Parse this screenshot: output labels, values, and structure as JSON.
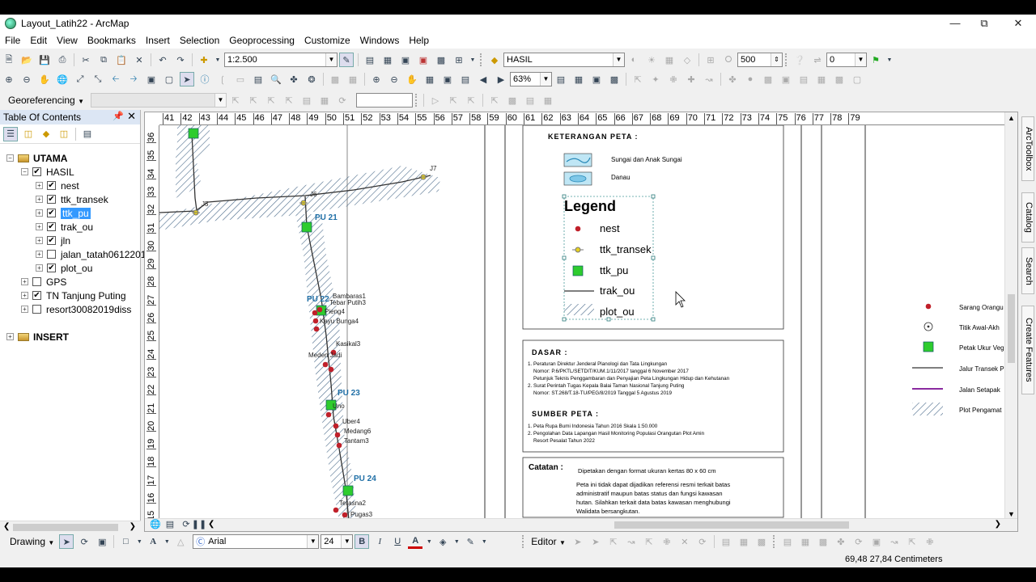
{
  "window": {
    "title": "Layout_Latih22 - ArcMap"
  },
  "menu": [
    "File",
    "Edit",
    "View",
    "Bookmarks",
    "Insert",
    "Selection",
    "Geoprocessing",
    "Customize",
    "Windows",
    "Help"
  ],
  "toolbar": {
    "scale": "1:2.500",
    "layer": "HASIL",
    "size_value": "500",
    "angle_value": "0",
    "zoom_percent": "63%"
  },
  "georef": {
    "label": "Georeferencing"
  },
  "toc": {
    "title": "Table Of Contents",
    "items": [
      {
        "label": "UTAMA",
        "level": 0,
        "checked": null,
        "expanded": true,
        "frame": true
      },
      {
        "label": "HASIL",
        "level": 1,
        "checked": true,
        "expanded": true
      },
      {
        "label": "nest",
        "level": 2,
        "checked": true
      },
      {
        "label": "ttk_transek",
        "level": 2,
        "checked": true
      },
      {
        "label": "ttk_pu",
        "level": 2,
        "checked": true,
        "selected": true
      },
      {
        "label": "trak_ou",
        "level": 2,
        "checked": true
      },
      {
        "label": "jln",
        "level": 2,
        "checked": true
      },
      {
        "label": "jalan_tatah0612201",
        "level": 2,
        "checked": false
      },
      {
        "label": "plot_ou",
        "level": 2,
        "checked": true
      },
      {
        "label": "GPS",
        "level": 1,
        "checked": false
      },
      {
        "label": "TN Tanjung Puting",
        "level": 1,
        "checked": true
      },
      {
        "label": "resort30082019diss",
        "level": 1,
        "checked": false
      },
      {
        "label": "INSERT",
        "level": 0,
        "checked": null,
        "frame": true
      }
    ]
  },
  "ruler_top": [
    "41",
    "42",
    "43",
    "44",
    "45",
    "46",
    "47",
    "48",
    "49",
    "50",
    "51",
    "52",
    "53",
    "54",
    "55",
    "56",
    "57",
    "58",
    "59",
    "60",
    "61",
    "62",
    "63",
    "64",
    "65",
    "66",
    "67",
    "68",
    "69",
    "70",
    "71",
    "72",
    "73",
    "74",
    "75",
    "76",
    "77",
    "78",
    "79"
  ],
  "ruler_left": [
    "36",
    "35",
    "34",
    "33",
    "32",
    "31",
    "30",
    "29",
    "28",
    "27",
    "26",
    "25",
    "24",
    "23",
    "22",
    "21",
    "20",
    "19",
    "18",
    "17",
    "16",
    "15"
  ],
  "map": {
    "plots": [
      "PU 21",
      "PU 22",
      "PU 23",
      "PU 24"
    ],
    "transect_points": [
      "J5",
      "J6",
      "J7"
    ],
    "nest_labels": [
      "Bambaras1",
      "Tebar Putih3",
      "Pieng4",
      "Kayu Bunga4",
      "Kasikal3",
      "Meden Jadi",
      "Uno",
      "Uber4",
      "Medang6",
      "Tantam3",
      "Terasna2",
      "Pugas3"
    ]
  },
  "keterangan": {
    "title": "KETERANGAN PETA :",
    "sungai": "Sungai dan Anak Sungai",
    "danau": "Danau",
    "legend_title": "Legend",
    "legend_items": [
      "nest",
      "ttk_transek",
      "ttk_pu",
      "trak_ou",
      "plot_ou"
    ]
  },
  "dasar": {
    "title": "DASAR :",
    "lines": [
      "1. Peraturan Direktur Jenderal Planologi dan Tata Lingkungan",
      "Nomor: P.6/PKTL/SETDIT/KUM.1/11/2017 tanggal 6 November 2017",
      "Petunjuk Teknis Penggambaran dan Penyajian Peta Lingkungan Hidup dan Kehutanan",
      "2. Surat Perintah Tugas Kepala Balai Taman Nasional Tanjung Puting",
      "Nomor: ST.268/T.18-TU/PEG/8/2019 Tanggal 5 Agustus 2019"
    ],
    "sumber_title": "SUMBER PETA :",
    "sumber_lines": [
      "1. Peta Rupa Bumi Indonesia Tahun 2016 Skala 1:50.000",
      "2. Pengolahan Data Lapangan Hasil Monitoring Populasi Orangutan Plot Amin",
      "Resort Pesalat Tahun 2022"
    ]
  },
  "catatan": {
    "title": "Catatan :",
    "line1": "Dipetakan dengan format ukuran kertas 80 x 60 cm",
    "para": [
      "Peta ini tidak dapat dijadikan referensi resmi terkait batas",
      "administratif maupun batas status dan fungsi kawasan",
      "hutan. Silahkan terkait data batas kawasan menghubungi",
      "Walidata bersangkutan."
    ]
  },
  "right_legend": [
    "Sarang Orangu",
    "Titik Awal-Akh",
    "Petak Ukur Veg",
    "Jalur Transek P",
    "Jalan Setapak",
    "Plot Pengamat"
  ],
  "sidetabs": [
    "ArcToolbox",
    "Catalog",
    "Search",
    "Create Features"
  ],
  "drawing": {
    "label": "Drawing",
    "font": "Arial",
    "size": "24",
    "editor": "Editor"
  },
  "status": {
    "coords": "69,48  27,84 Centimeters"
  },
  "colors": {
    "nest": "#c0202a",
    "plot": "#2ecc2e",
    "track": "#333333",
    "hatch": "#4a6a8a",
    "selection": "#3399ff"
  }
}
